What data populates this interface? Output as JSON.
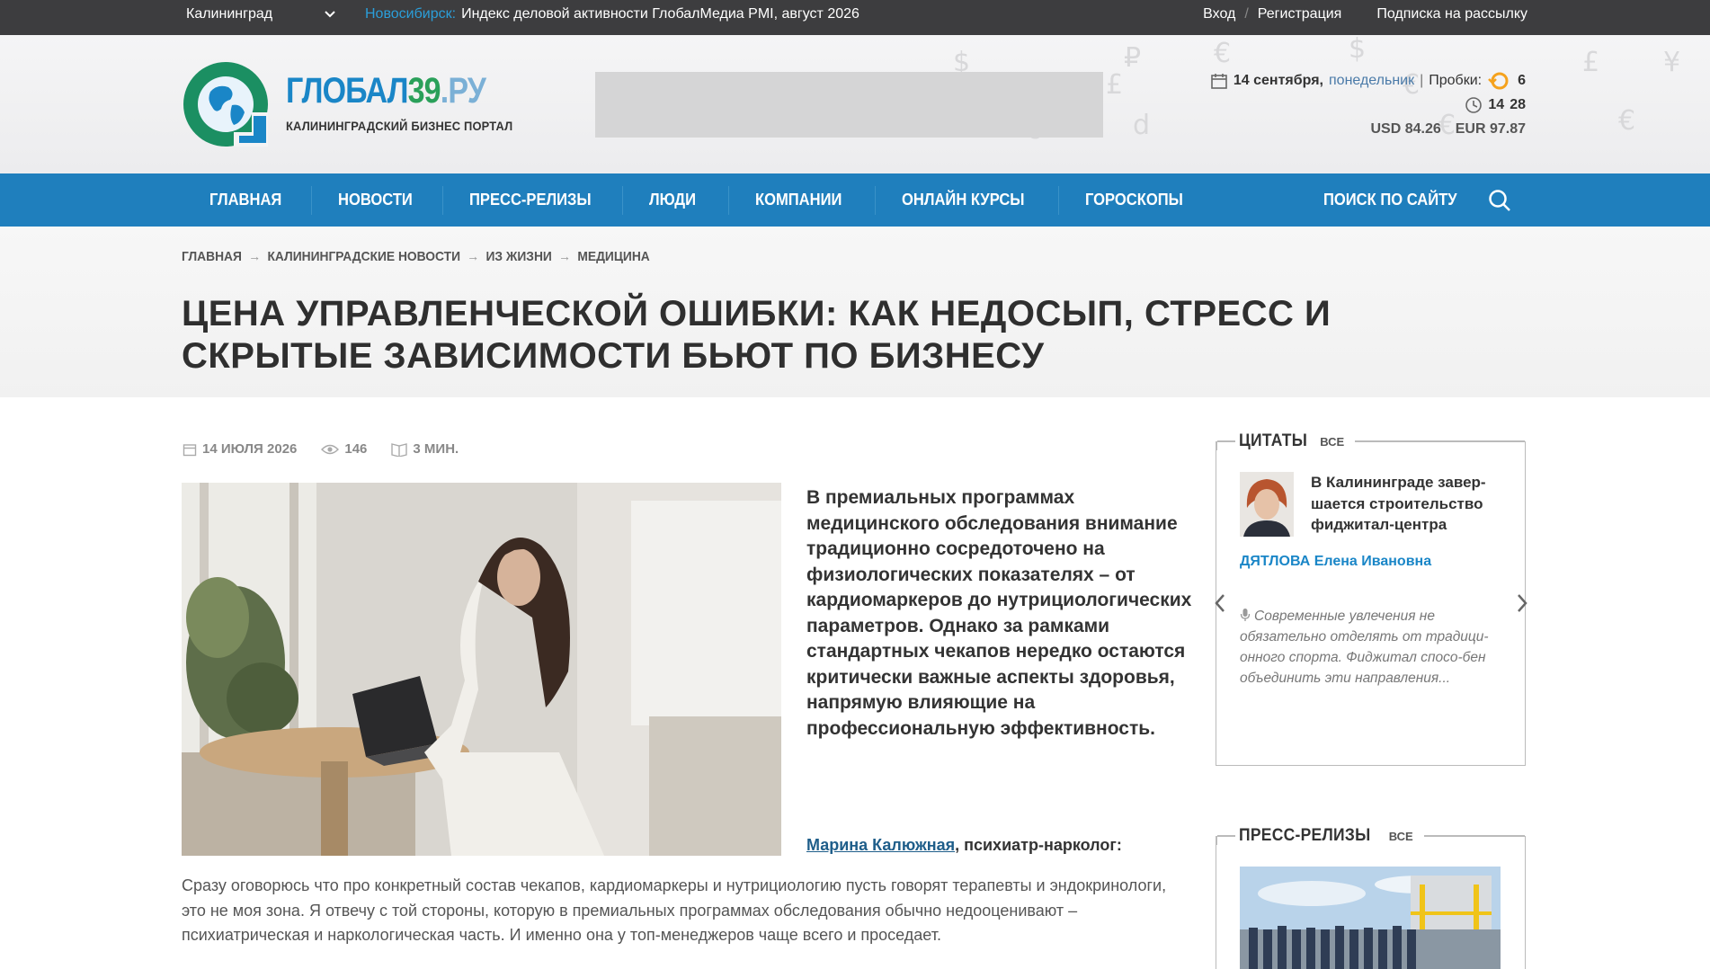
{
  "topbar": {
    "city": "Калининград",
    "ticker_city": "Новосибирск:",
    "ticker_text": "Индекс деловой активности ГлобалМедиа PMI, август 2026",
    "login": "Вход",
    "sep": "/",
    "register": "Регистрация",
    "subscribe": "Подписка на рассылку"
  },
  "header": {
    "logo_part1": "ГЛОБАЛ",
    "logo_part2": "39",
    "logo_part3": ".РУ",
    "logo_subtitle": "КАЛИНИНГРАДСКИЙ БИЗНЕС ПОРТАЛ",
    "date": "14 сентября,",
    "weekday": "понедельник",
    "divider": "|",
    "traffic_label": "Пробки:",
    "traffic_value": "6",
    "time_h": "14",
    "time_m": "28",
    "usd": "USD 84.26",
    "eur": "EUR 97.87"
  },
  "nav": {
    "items": [
      "ГЛАВНАЯ",
      "НОВОСТИ",
      "ПРЕСС-РЕЛИЗЫ",
      "ЛЮДИ",
      "КОМПАНИИ",
      "ОНЛАЙН КУРСЫ",
      "ГОРОСКОПЫ"
    ],
    "search": "ПОИСК ПО САЙТУ"
  },
  "breadcrumbs": [
    "ГЛАВНАЯ",
    "КАЛИНИНГРАДСКИЕ НОВОСТИ",
    "ИЗ ЖИЗНИ",
    "МЕДИЦИНА"
  ],
  "breadcrumb_arrow": "→",
  "article": {
    "title": "ЦЕНА УПРАВЛЕНЧЕСКОЙ ОШИБКИ: КАК НЕДОСЫП, СТРЕСС И СКРЫТЫЕ ЗАВИСИМОСТИ БЬЮТ ПО БИЗНЕСУ",
    "date": "14 ИЮЛЯ 2026",
    "views": "146",
    "read_time": "3 МИН.",
    "lead": "В премиальных программах медицинского обследования внимание традиционно сосредоточено на физиологических показателях – от кардиомаркеров до нутрициологических параметров. Однако за рамками стандартных чекапов нередко остаются критически важные аспекты здоровья, напрямую влияющие на профессиональную эффективность.",
    "author_name": "Марина Калюжная",
    "author_role": ", психиатр-нарколог:",
    "body": "Сразу оговорюсь что про конкретный состав чекапов, кардиомаркеры и нутрициологию пусть говорят терапевты и эндокринологи, это не моя зона. Я отвечу с той стороны, которую в премиальных программах обследования обычно недооценивают – психиатрическая и наркологическая часть. И именно она у топ-менеджеров чаще всего и проседает."
  },
  "quotes": {
    "title": "ЦИТАТЫ",
    "all": "ВСЕ",
    "headline": "В Калининграде завер-шается строительство фиджитал-центра",
    "person_surname": "ДЯТЛОВА",
    "person_name": " Елена Ивановна",
    "text": "Современные увлечения не обязательно отделять от традици-онного спорта. Фиджитал спосо-бен объединить эти направления..."
  },
  "press": {
    "title": "ПРЕСС-РЕЛИЗЫ",
    "all": "ВСЕ"
  },
  "colors": {
    "topbar": "#3d3d3f",
    "nav": "#1f7fbd",
    "accent_blue": "#1a86c7",
    "accent_green": "#2aa05a"
  }
}
